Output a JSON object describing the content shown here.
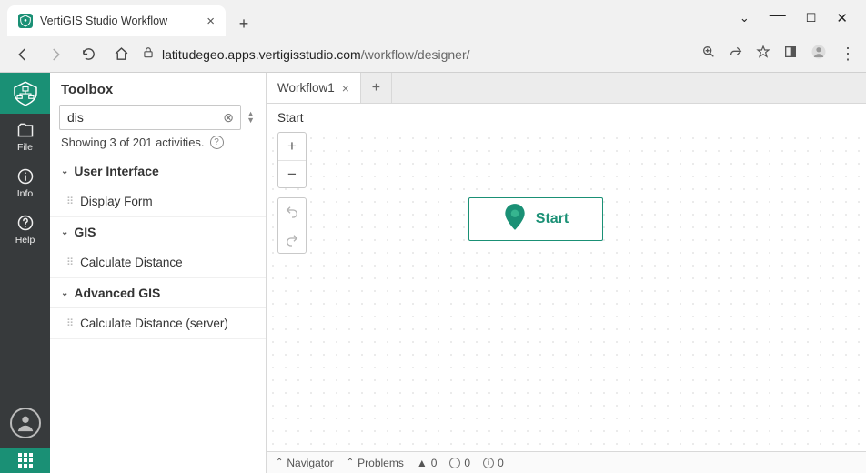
{
  "browser": {
    "tab_title": "VertiGIS Studio Workflow",
    "url_host": "latitudegeo.apps.vertigisstudio.com",
    "url_path": "/workflow/designer/"
  },
  "rail": {
    "items": [
      {
        "label": "File"
      },
      {
        "label": "Info"
      },
      {
        "label": "Help"
      }
    ]
  },
  "toolbox": {
    "title": "Toolbox",
    "search_value": "dis",
    "status_text": "Showing 3 of 201 activities.",
    "groups": [
      {
        "name": "User Interface",
        "items": [
          "Display Form"
        ]
      },
      {
        "name": "GIS",
        "items": [
          "Calculate Distance"
        ]
      },
      {
        "name": "Advanced GIS",
        "items": [
          "Calculate Distance (server)"
        ]
      }
    ]
  },
  "canvas": {
    "doc_tab": "Workflow1",
    "breadcrumb": "Start",
    "start_label": "Start"
  },
  "status_bar": {
    "navigator": "Navigator",
    "problems": "Problems",
    "warn_count": "0",
    "info_count": "0",
    "err_count": "0"
  }
}
